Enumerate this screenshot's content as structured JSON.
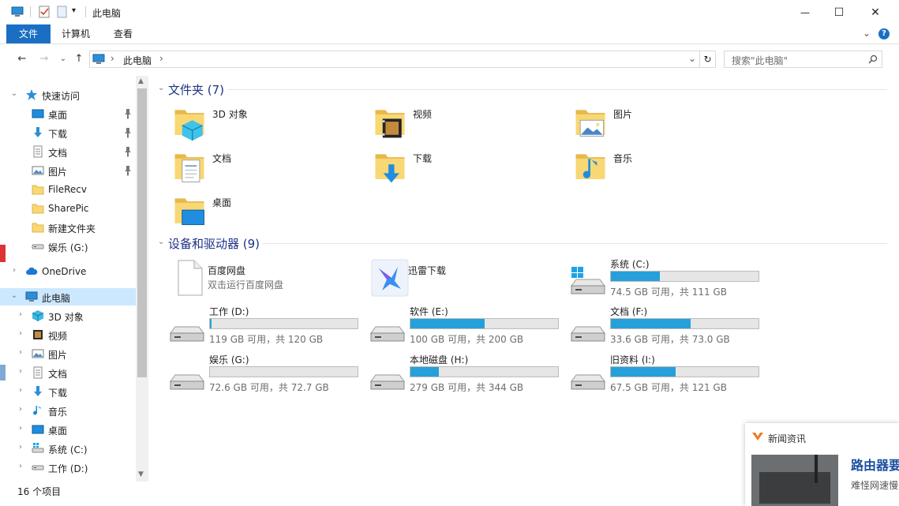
{
  "window": {
    "title": "此电脑",
    "buttons": {
      "minimize": "—",
      "maximize": "☐",
      "close": "✕"
    }
  },
  "ribbon": {
    "tabs": [
      {
        "label": "文件"
      },
      {
        "label": "计算机"
      },
      {
        "label": "查看"
      }
    ],
    "collapse_glyph": "⌄",
    "help_glyph": "?"
  },
  "address": {
    "back": "←",
    "forward": "→",
    "recent": "⌄",
    "up": "↑",
    "path": [
      "此电脑"
    ],
    "separator": "›",
    "dropdown": "⌄",
    "refresh": "↻"
  },
  "search": {
    "placeholder": "搜索\"此电脑\""
  },
  "nav": {
    "items": [
      {
        "label": "快速访问",
        "icon": "star-icon",
        "chev": "⌄",
        "pinned": false
      },
      {
        "label": "桌面",
        "icon": "desktop-icon",
        "chev": "",
        "pinned": true
      },
      {
        "label": "下载",
        "icon": "download-icon",
        "chev": "",
        "pinned": true
      },
      {
        "label": "文档",
        "icon": "document-icon",
        "chev": "",
        "pinned": true
      },
      {
        "label": "图片",
        "icon": "pictures-icon",
        "chev": "",
        "pinned": true
      },
      {
        "label": "FileRecv",
        "icon": "folder-icon",
        "chev": "",
        "pinned": false
      },
      {
        "label": "SharePic",
        "icon": "folder-icon",
        "chev": "",
        "pinned": false
      },
      {
        "label": "新建文件夹",
        "icon": "folder-icon",
        "chev": "",
        "pinned": false
      },
      {
        "label": "娱乐 (G:)",
        "icon": "drive-icon",
        "chev": "",
        "pinned": false
      },
      {
        "label": "OneDrive",
        "icon": "cloud-icon",
        "chev": "›",
        "pinned": false
      },
      {
        "label": "此电脑",
        "icon": "computer-icon",
        "chev": "⌄",
        "pinned": false,
        "selected": true
      },
      {
        "label": "3D 对象",
        "icon": "cube-icon",
        "chev": "›",
        "pinned": false
      },
      {
        "label": "视频",
        "icon": "video-icon",
        "chev": "›",
        "pinned": false
      },
      {
        "label": "图片",
        "icon": "pictures-icon",
        "chev": "›",
        "pinned": false
      },
      {
        "label": "文档",
        "icon": "document-icon",
        "chev": "›",
        "pinned": false
      },
      {
        "label": "下载",
        "icon": "download-icon",
        "chev": "›",
        "pinned": false
      },
      {
        "label": "音乐",
        "icon": "music-icon",
        "chev": "›",
        "pinned": false
      },
      {
        "label": "桌面",
        "icon": "desktop-icon",
        "chev": "›",
        "pinned": false
      },
      {
        "label": "系统 (C:)",
        "icon": "windows-drive-icon",
        "chev": "›",
        "pinned": false
      },
      {
        "label": "工作 (D:)",
        "icon": "drive-icon",
        "chev": "›",
        "pinned": false
      }
    ]
  },
  "folders": {
    "heading": "文件夹 (7)",
    "chev": "⌄",
    "items": [
      {
        "label": "3D 对象",
        "icon": "cube-icon"
      },
      {
        "label": "视频",
        "icon": "video-icon"
      },
      {
        "label": "图片",
        "icon": "pictures-icon"
      },
      {
        "label": "文档",
        "icon": "document-icon"
      },
      {
        "label": "下载",
        "icon": "download-icon"
      },
      {
        "label": "音乐",
        "icon": "music-icon"
      },
      {
        "label": "桌面",
        "icon": "desktop-icon"
      }
    ]
  },
  "devices": {
    "heading": "设备和驱动器 (9)",
    "chev": "⌄",
    "apps": [
      {
        "label": "百度网盘",
        "sub": "双击运行百度网盘",
        "icon": "blank-file-icon"
      },
      {
        "label": "迅雷下载",
        "sub": "",
        "icon": "thunder-bird-icon"
      }
    ],
    "drives": [
      {
        "label": "系统 (C:)",
        "size": "74.5 GB 可用，共 111 GB",
        "used_fraction": 0.33,
        "icon": "windows-drive-icon"
      },
      {
        "label": "工作 (D:)",
        "size": "119 GB 可用，共 120 GB",
        "used_fraction": 0.01,
        "icon": "drive-icon"
      },
      {
        "label": "软件 (E:)",
        "size": "100 GB 可用，共 200 GB",
        "used_fraction": 0.5,
        "icon": "drive-icon"
      },
      {
        "label": "文档 (F:)",
        "size": "33.6 GB 可用，共 73.0 GB",
        "used_fraction": 0.54,
        "icon": "drive-icon"
      },
      {
        "label": "娱乐 (G:)",
        "size": "72.6 GB 可用，共 72.7 GB",
        "used_fraction": 0.0,
        "icon": "drive-icon"
      },
      {
        "label": "本地磁盘 (H:)",
        "size": "279 GB 可用，共 344 GB",
        "used_fraction": 0.19,
        "icon": "drive-icon"
      },
      {
        "label": "旧资料 (I:)",
        "size": "67.5 GB 可用，共 121 GB",
        "used_fraction": 0.44,
        "icon": "drive-icon"
      }
    ]
  },
  "status": {
    "count": "16 个项目"
  },
  "news": {
    "title": "新闻资讯",
    "headline": "路由器要",
    "snippet": "难怪网速慢"
  },
  "colors": {
    "accent": "#1a6fc4",
    "drive_fill": "#26a0da",
    "selection": "#cce8ff",
    "heading": "#1e3287"
  }
}
